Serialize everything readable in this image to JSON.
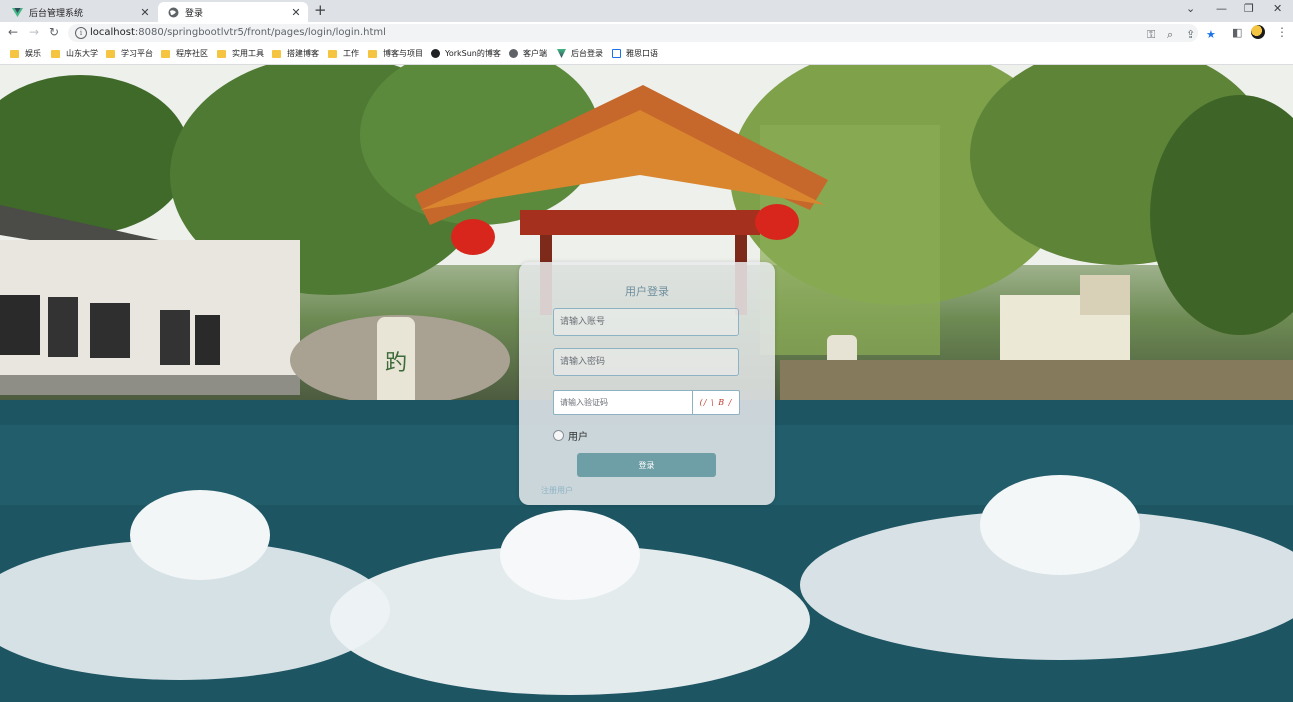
{
  "browser": {
    "tabs": [
      {
        "label": "后台管理系统",
        "active": false
      },
      {
        "label": "登录",
        "active": true
      }
    ],
    "url_host": "localhost",
    "url_path": ":8080/springbootlvtr5/front/pages/login/login.html",
    "bookmarks": [
      {
        "label": "娱乐",
        "icon": "folder-icon"
      },
      {
        "label": "山东大学",
        "icon": "folder-icon"
      },
      {
        "label": "学习平台",
        "icon": "folder-icon"
      },
      {
        "label": "程序社区",
        "icon": "folder-icon"
      },
      {
        "label": "实用工具",
        "icon": "folder-icon"
      },
      {
        "label": "搭建博客",
        "icon": "folder-icon"
      },
      {
        "label": "工作",
        "icon": "folder-icon"
      },
      {
        "label": "博客与项目",
        "icon": "folder-icon"
      },
      {
        "label": "YorkSun的博客",
        "icon": "blog-icon"
      },
      {
        "label": "客户端",
        "icon": "globe-icon"
      },
      {
        "label": "后台登录",
        "icon": "vue-icon"
      },
      {
        "label": "雅思口语",
        "icon": "calendar-icon"
      }
    ]
  },
  "login": {
    "title": "用户登录",
    "username_placeholder": "请输入账号",
    "password_placeholder": "请输入密码",
    "captcha_placeholder": "请输入验证码",
    "captcha_text": "(/ \\ B /",
    "role_label": "用户",
    "login_button": "登录",
    "register_link": "注册用户"
  },
  "colors": {
    "accent": "#6f9fa6",
    "title": "#6f8f9e",
    "link": "#8fb4c6"
  }
}
